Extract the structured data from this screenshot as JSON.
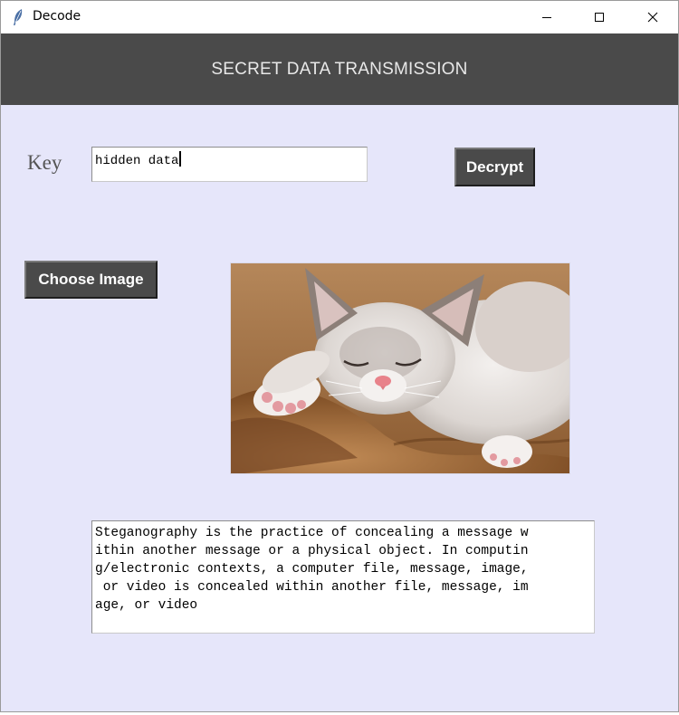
{
  "window": {
    "title": "Decode",
    "icon": "feather-icon"
  },
  "header": {
    "title": "SECRET DATA TRANSMISSION"
  },
  "form": {
    "key_label": "Key",
    "key_value": "hidden data",
    "decrypt_label": "Decrypt",
    "choose_image_label": "Choose Image"
  },
  "image": {
    "subject": "sleeping-kitten-photo"
  },
  "message": {
    "lines": [
      "Steganography is the practice of concealing a message w",
      "ithin another message or a physical object. In computin",
      "g/electronic contexts, a computer file, message, image,",
      " or video is concealed within another file, message, im",
      "age, or video"
    ]
  },
  "colors": {
    "background": "#e6e6fa",
    "header_bg": "#4a4a4a",
    "button_bg": "#4a4a4a"
  }
}
